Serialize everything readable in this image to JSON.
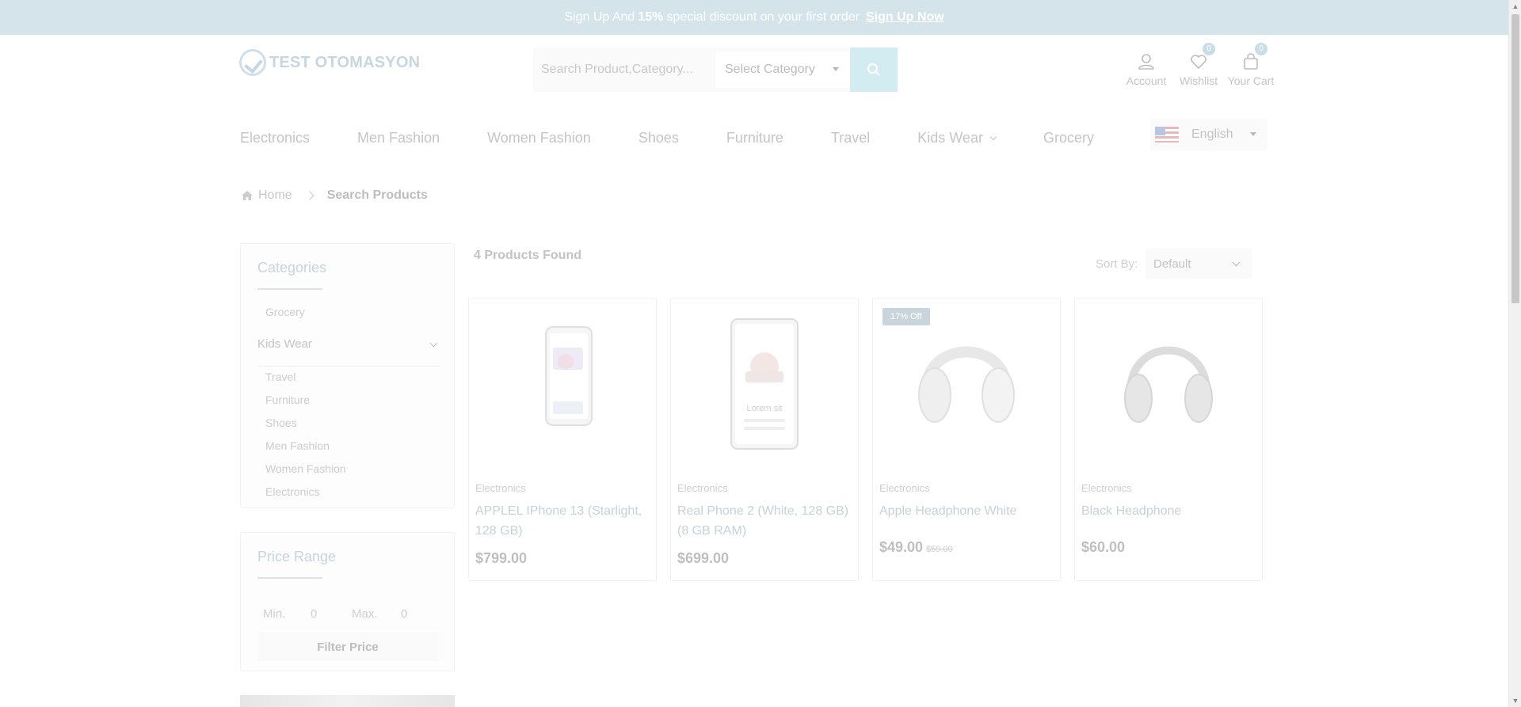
{
  "banner": {
    "text_before": "Sign Up And",
    "discount": "15%",
    "text_after": "special discount on your first order",
    "link_label": "Sign Up Now"
  },
  "logo": {
    "text": "TEST OTOMASYON"
  },
  "search": {
    "placeholder": "Search Product,Category...",
    "category_label": "Select Category"
  },
  "header_icons": {
    "account_label": "Account",
    "wishlist_label": "Wishlist",
    "wishlist_count": "0",
    "cart_label": "Your Cart",
    "cart_count": "0"
  },
  "nav": {
    "items": [
      "Electronics",
      "Men Fashion",
      "Women Fashion",
      "Shoes",
      "Furniture",
      "Travel",
      "Kids Wear",
      "Grocery"
    ]
  },
  "language": {
    "selected": "English"
  },
  "breadcrumb": {
    "home": "Home",
    "current": "Search Products"
  },
  "sidebar": {
    "categories_title": "Categories",
    "top_item": "Grocery",
    "parent_item": "Kids Wear",
    "sub_items": [
      "Travel",
      "Furniture",
      "Shoes",
      "Men Fashion",
      "Women Fashion",
      "Electronics"
    ],
    "price_title": "Price Range",
    "min_label": "Min.",
    "min_value": "0",
    "max_label": "Max.",
    "max_value": "0",
    "filter_button": "Filter Price"
  },
  "results": {
    "count_text": "4 Products Found",
    "sort_label": "Sort By:",
    "sort_value": "Default"
  },
  "products": [
    {
      "category": "Electronics",
      "title": "APPLEL IPhone 13 (Starlight, 128 GB)",
      "price": "$799.00",
      "old_price": "",
      "badge": ""
    },
    {
      "category": "Electronics",
      "title": "Real Phone 2 (White, 128 GB) (8 GB RAM)",
      "price": "$699.00",
      "old_price": "",
      "badge": "",
      "screen_text": "Lorem sit"
    },
    {
      "category": "Electronics",
      "title": "Apple Headphone White",
      "price": "$49.00",
      "old_price": "$59.00",
      "badge": "17% Off"
    },
    {
      "category": "Electronics",
      "title": "Black Headphone",
      "price": "$60.00",
      "old_price": "",
      "badge": ""
    }
  ]
}
